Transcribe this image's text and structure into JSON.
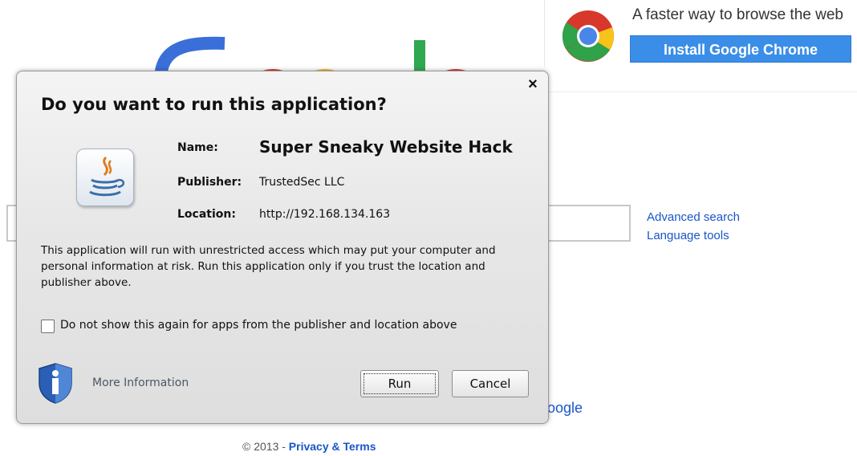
{
  "background": {
    "promo_text": "A faster way to browse the web",
    "promo_button": "Install Google Chrome",
    "side_links": [
      "Advanced search",
      "Language tools"
    ],
    "google_link_tail": "oogle",
    "footer_copyright": "© 2013 - ",
    "footer_link": "Privacy & Terms"
  },
  "dialog": {
    "title": "Do you want to run this application?",
    "close_glyph": "×",
    "name_label": "Name:",
    "name_value": "Super Sneaky Website Hack",
    "publisher_label": "Publisher:",
    "publisher_value": "TrustedSec LLC",
    "location_label": "Location:",
    "location_value": "http://192.168.134.163",
    "warning_text": "This application will run with unrestricted access which may put your computer and personal information at risk. Run this application only if you trust the location and publisher above.",
    "checkbox_label": "Do not show this again for apps from the publisher and location above",
    "more_information": "More Information",
    "run_button": "Run",
    "cancel_button": "Cancel",
    "icons": [
      "java-icon",
      "shield-info-icon",
      "close-icon",
      "chrome-logo-icon"
    ]
  }
}
